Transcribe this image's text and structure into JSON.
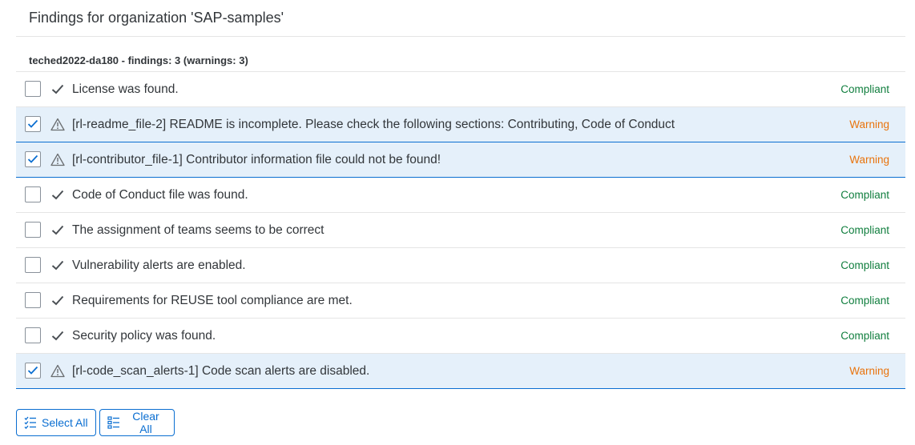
{
  "header": {
    "title": "Findings for organization 'SAP-samples'"
  },
  "group": {
    "header": "teched2022-da180 - findings: 3 (warnings: 3)"
  },
  "findings": [
    {
      "text": "License was found.",
      "status": "Compliant",
      "kind": "compliant",
      "selected": false
    },
    {
      "text": "[rl-readme_file-2] README is incomplete. Please check the following sections: Contributing, Code of Conduct",
      "status": "Warning",
      "kind": "warning",
      "selected": true
    },
    {
      "text": "[rl-contributor_file-1] Contributor information file could not be found!",
      "status": "Warning",
      "kind": "warning",
      "selected": true
    },
    {
      "text": "Code of Conduct file was found.",
      "status": "Compliant",
      "kind": "compliant",
      "selected": false
    },
    {
      "text": "The assignment of teams seems to be correct",
      "status": "Compliant",
      "kind": "compliant",
      "selected": false
    },
    {
      "text": "Vulnerability alerts are enabled.",
      "status": "Compliant",
      "kind": "compliant",
      "selected": false
    },
    {
      "text": "Requirements for REUSE tool compliance are met.",
      "status": "Compliant",
      "kind": "compliant",
      "selected": false
    },
    {
      "text": "Security policy was found.",
      "status": "Compliant",
      "kind": "compliant",
      "selected": false
    },
    {
      "text": "[rl-code_scan_alerts-1] Code scan alerts are disabled.",
      "status": "Warning",
      "kind": "warning",
      "selected": true
    }
  ],
  "toolbar": {
    "select_all_label": "Select All",
    "select_all_icon": "multi-select-icon",
    "clear_all_label": "Clear All",
    "clear_all_icon": "clear-selection-icon"
  },
  "colors": {
    "accent": "#0a6ed1",
    "compliant": "#107e3e",
    "warning": "#e9730c",
    "selected_row": "#e5f0fa"
  }
}
